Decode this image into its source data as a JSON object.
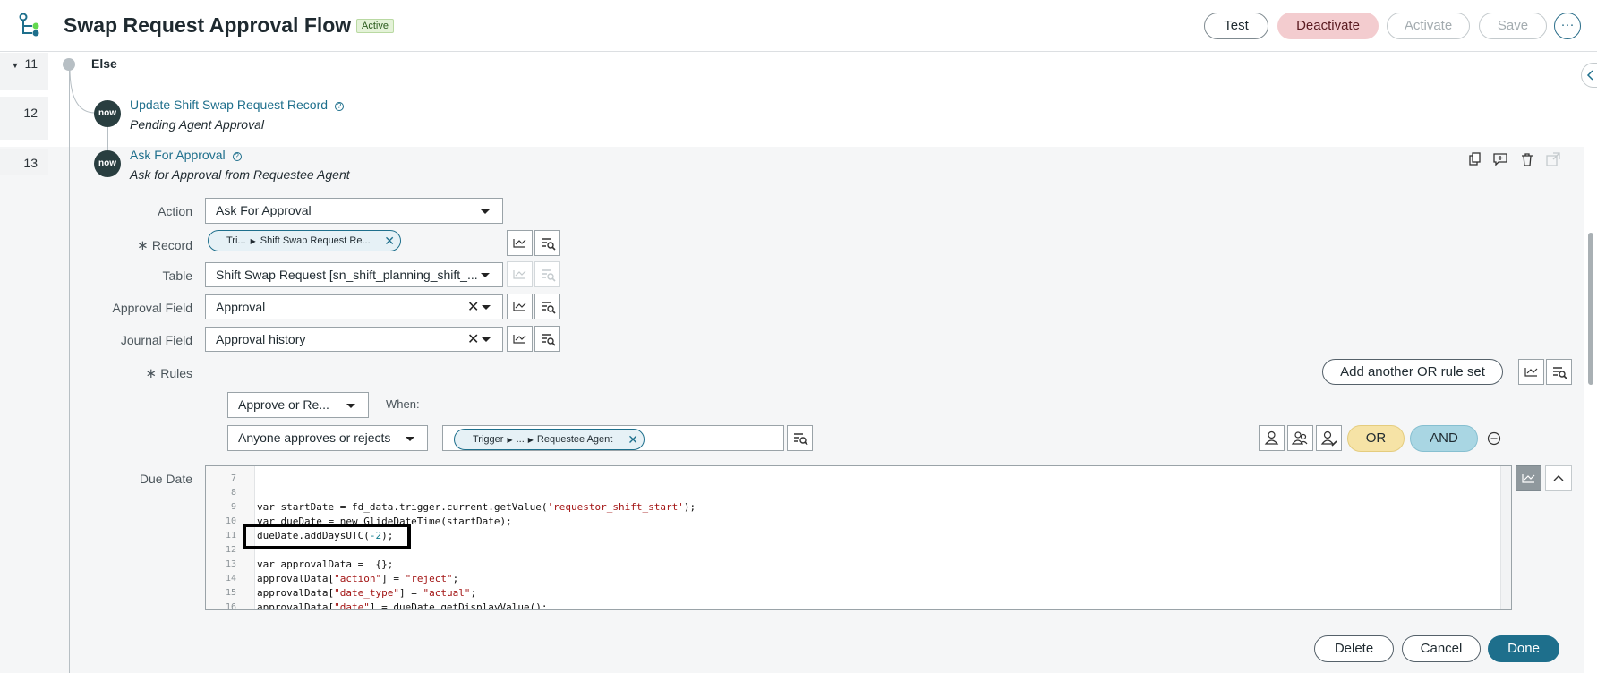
{
  "header": {
    "title": "Swap Request Approval Flow",
    "status": "Active",
    "buttons": {
      "test": "Test",
      "deactivate": "Deactivate",
      "activate": "Activate",
      "save": "Save",
      "more": "···"
    }
  },
  "rows": [
    {
      "number": "11",
      "label": "Else"
    },
    {
      "number": "12",
      "action": "Update Shift Swap Request Record",
      "subtitle": "Pending Agent Approval",
      "badge": "now"
    },
    {
      "number": "13",
      "action": "Ask For Approval",
      "subtitle": "Ask for Approval from Requestee Agent",
      "badge": "now"
    }
  ],
  "form": {
    "action": {
      "label": "Action",
      "value": "Ask For Approval"
    },
    "record": {
      "label": "Record",
      "pill_prefix": "Tri...",
      "pill_value": "Shift Swap Request Re..."
    },
    "table": {
      "label": "Table",
      "value": "Shift Swap Request [sn_shift_planning_shift_..."
    },
    "approval_field": {
      "label": "Approval Field",
      "value": "Approval"
    },
    "journal_field": {
      "label": "Journal Field",
      "value": "Approval history"
    },
    "rules": {
      "label": "Rules",
      "add_or_rule_set": "Add another OR rule set",
      "approve_select": "Approve or Re...",
      "when_label": "When:",
      "condition_select": "Anyone approves or rejects",
      "pill_prefix": "Trigger",
      "pill_mid": "...",
      "pill_value": "Requestee Agent",
      "or_label": "OR",
      "and_label": "AND"
    },
    "due_date": {
      "label": "Due Date",
      "lines": [
        {
          "n": "7",
          "text": ""
        },
        {
          "n": "8",
          "text": ""
        },
        {
          "n": "9",
          "text": "var startDate = fd_data.trigger.current.getValue(",
          "str": "'requestor_shift_start'",
          "tail": ");"
        },
        {
          "n": "10",
          "text": "var dueDate = new GlideDateTime(startDate);"
        },
        {
          "n": "11",
          "text": "dueDate.addDaysUTC(",
          "num": "-2",
          "tail": ");"
        },
        {
          "n": "12",
          "text": ""
        },
        {
          "n": "13",
          "text": "var approvalData =  {};"
        },
        {
          "n": "14",
          "text": "approvalData[",
          "str": "\"action\"",
          "tail": "] = ",
          "str2": "\"reject\"",
          "tail2": ";"
        },
        {
          "n": "15",
          "text": "approvalData[",
          "str": "\"date_type\"",
          "tail": "] = ",
          "str2": "\"actual\"",
          "tail2": ";"
        },
        {
          "n": "16",
          "text": "approvalData[",
          "str": "\"date\"",
          "tail": "] = dueDate.getDisplayValue();"
        }
      ]
    }
  },
  "footer": {
    "delete": "Delete",
    "cancel": "Cancel",
    "done": "Done"
  },
  "colors": {
    "accent": "#1e6f8c",
    "deactivate": "#f3cccf",
    "or": "#f6e3a6",
    "and": "#a9d6e3"
  }
}
